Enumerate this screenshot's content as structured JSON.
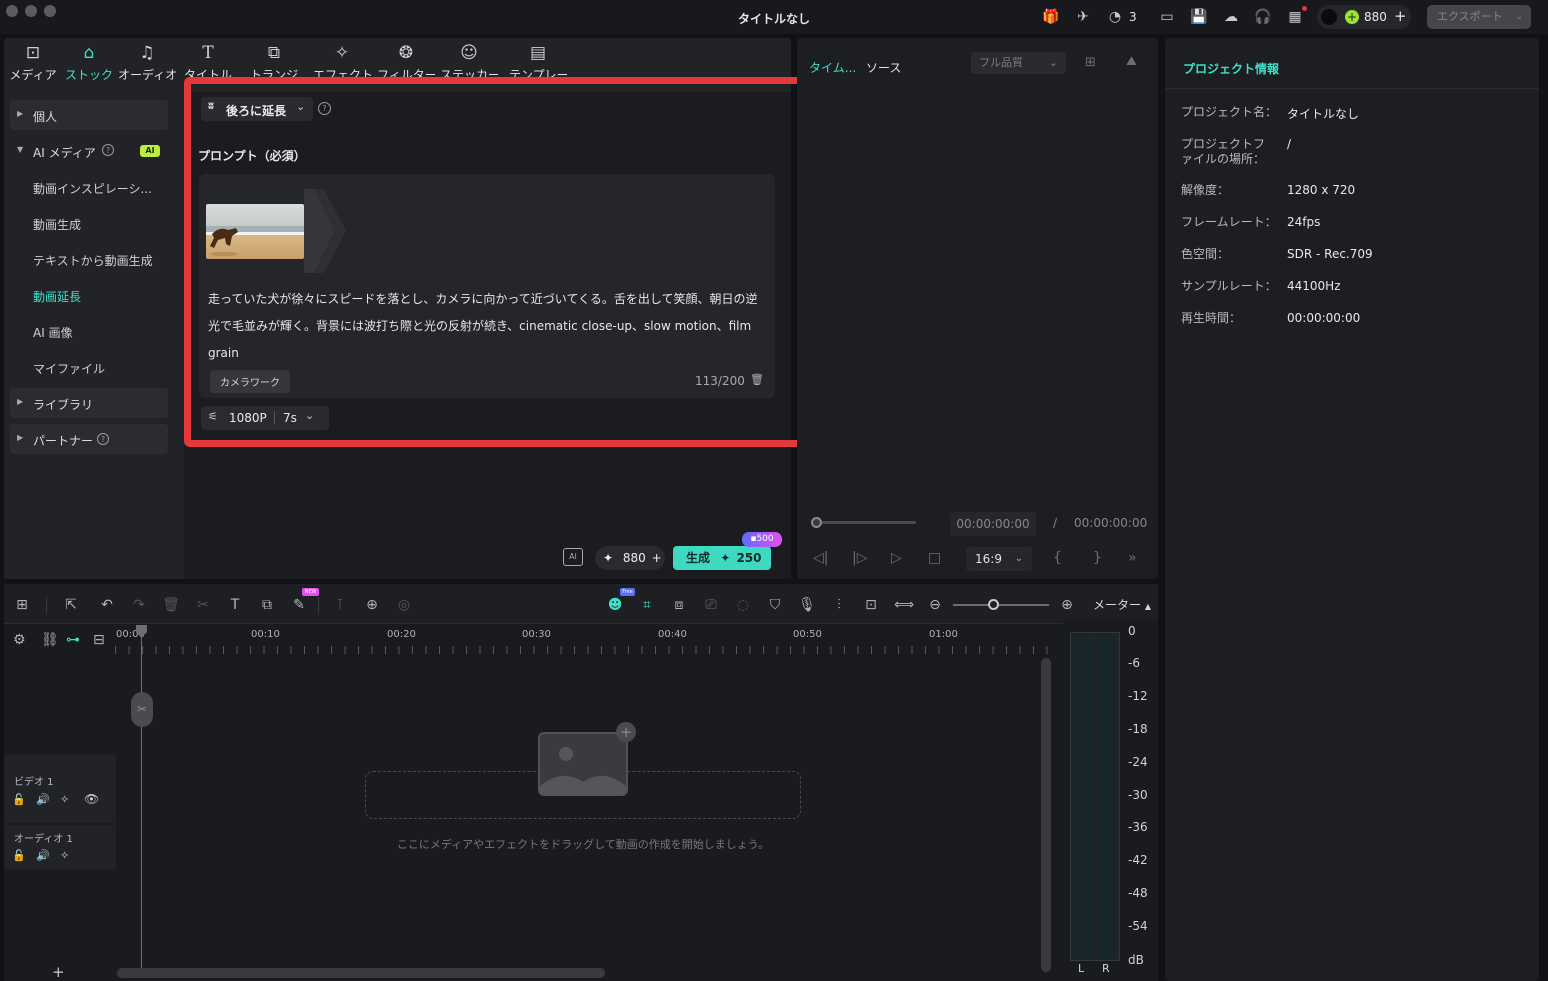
{
  "app": {
    "title": "タイトルなし",
    "notifications": "3",
    "credits": "880",
    "export_label": "エクスポート"
  },
  "top_nav": [
    {
      "label": "メディア",
      "icon": "media-icon"
    },
    {
      "label": "ストック",
      "icon": "stock-icon",
      "active": true
    },
    {
      "label": "オーディオ",
      "icon": "music-icon"
    },
    {
      "label": "タイトル",
      "icon": "title-icon"
    },
    {
      "label": "トランジ",
      "icon": "transition-icon"
    },
    {
      "label": "エフェクト",
      "icon": "effects-icon"
    },
    {
      "label": "フィルター",
      "icon": "filter-icon"
    },
    {
      "label": "ステッカー",
      "icon": "sticker-icon"
    },
    {
      "label": "テンプレート",
      "icon": "template-icon"
    }
  ],
  "sidebar": {
    "groups": {
      "personal": "個人",
      "ai_media": "AI メディア",
      "ai_badge": "AI",
      "library": "ライブラリ",
      "partner": "パートナー"
    },
    "items": [
      {
        "label": "動画インスピレーシ..."
      },
      {
        "label": "動画生成"
      },
      {
        "label": "テキストから動画生成"
      },
      {
        "label": "動画延長",
        "active": true
      },
      {
        "label": "AI 画像"
      },
      {
        "label": "マイファイル"
      }
    ]
  },
  "extend": {
    "mode_label": "後ろに延長",
    "prompt_heading": "プロンプト（必須）",
    "prompt_text": "走っていた犬が徐々にスピードを落とし、カメラに向かって近づいてくる。舌を出して笑顔、朝日の逆光で毛並みが輝く。背景には波打ち際と光の反射が続き、cinematic close-up、slow motion、film grain",
    "chip": "カメラワーク",
    "char_count": "113/200",
    "resolution": "1080P",
    "duration": "7s"
  },
  "generate": {
    "credits": "880",
    "label": "生成",
    "cost": "250",
    "badge": "500"
  },
  "preview": {
    "tab_timeline": "タイム...",
    "tab_source": "ソース",
    "quality": "フル品質",
    "timecode_current": "00:00:00:00",
    "separator": "/",
    "timecode_total": "00:00:00:00",
    "aspect": "16:9"
  },
  "project_info": {
    "title": "プロジェクト情報",
    "rows": [
      {
        "key": "プロジェクト名：",
        "value": "タイトルなし"
      },
      {
        "key": "プロジェクトファイルの場所：",
        "value": "/"
      },
      {
        "key": "解像度：",
        "value": "1280 x 720"
      },
      {
        "key": "フレームレート：",
        "value": "24fps"
      },
      {
        "key": "色空間：",
        "value": "SDR - Rec.709"
      },
      {
        "key": "サンプルレート：",
        "value": "44100Hz"
      },
      {
        "key": "再生時間：",
        "value": "00:00:00:00"
      }
    ]
  },
  "timeline": {
    "ruler": [
      "00:00",
      "00:10",
      "00:20",
      "00:30",
      "00:40",
      "00:50",
      "01:00"
    ],
    "video_track": "ビデオ 1",
    "audio_track": "オーディオ 1",
    "drop_hint": "ここにメディアやエフェクトをドラッグして動画の作成を開始しましょう。",
    "meter_label": "メーター",
    "meter_scale": [
      "0",
      "-6",
      "-12",
      "-18",
      "-24",
      "-30",
      "-36",
      "-42",
      "-48",
      "-54",
      "dB"
    ],
    "meter_channels": [
      "L",
      "R"
    ],
    "free_badge": "Free",
    "new_badge": "NEW"
  }
}
